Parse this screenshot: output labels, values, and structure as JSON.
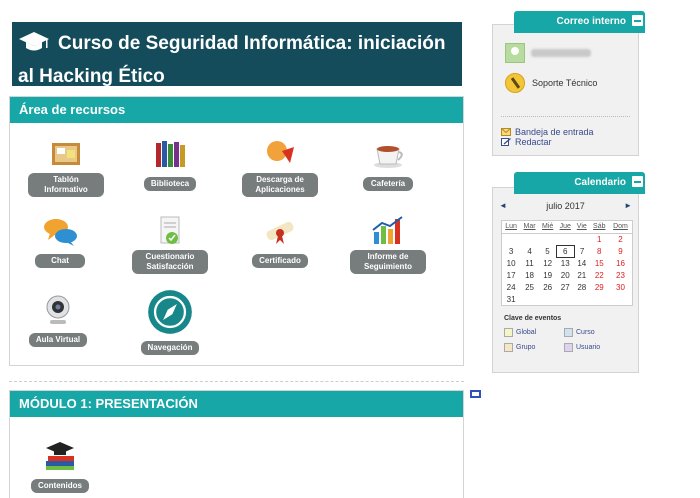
{
  "course": {
    "title": "Curso de Seguridad Informática: iniciación al Hacking Ético",
    "icon": "graduation-cap-icon"
  },
  "resources": {
    "header": "Área de recursos",
    "items": [
      {
        "label": "Tablón Informativo",
        "icon": "bulletin-board-icon"
      },
      {
        "label": "Biblioteca",
        "icon": "books-icon"
      },
      {
        "label": "Descarga de Aplicaciones",
        "icon": "download-apps-icon"
      },
      {
        "label": "Cafetería",
        "icon": "coffee-cup-icon"
      },
      {
        "label": "Chat",
        "icon": "chat-bubbles-icon"
      },
      {
        "label": "Cuestionario Satisfacción",
        "icon": "questionnaire-icon"
      },
      {
        "label": "Certificado",
        "icon": "diploma-icon"
      },
      {
        "label": "Informe de Seguimiento",
        "icon": "report-chart-icon"
      },
      {
        "label": "Aula Virtual",
        "icon": "webcam-icon"
      },
      {
        "label": "Navegación",
        "icon": "compass-icon"
      }
    ]
  },
  "module1": {
    "header": "MÓDULO 1: PRESENTACIÓN",
    "items": [
      {
        "label": "Contenidos",
        "icon": "books-cap-icon"
      }
    ]
  },
  "mail": {
    "title": "Correo interno",
    "support": "Soporte Técnico",
    "inbox": "Bandeja de entrada",
    "compose": "Redactar"
  },
  "calendar": {
    "title": "Calendario",
    "month": "julio 2017",
    "prev": "◄",
    "next": "►",
    "weekdays": [
      "Lun",
      "Mar",
      "Mié",
      "Jue",
      "Vie",
      "Sáb",
      "Dom"
    ],
    "weeks": [
      [
        "",
        "",
        "",
        "",
        "",
        "1",
        "2"
      ],
      [
        "3",
        "4",
        "5",
        "6",
        "7",
        "8",
        "9"
      ],
      [
        "10",
        "11",
        "12",
        "13",
        "14",
        "15",
        "16"
      ],
      [
        "17",
        "18",
        "19",
        "20",
        "21",
        "22",
        "23"
      ],
      [
        "24",
        "25",
        "26",
        "27",
        "28",
        "29",
        "30"
      ],
      [
        "31",
        "",
        "",
        "",
        "",
        "",
        ""
      ]
    ],
    "today": "6",
    "clave_title": "Clave de eventos",
    "clave": [
      {
        "label": "Global",
        "color": "#f4f6c8"
      },
      {
        "label": "Curso",
        "color": "#cfe2f2"
      },
      {
        "label": "Grupo",
        "color": "#f6e6c6"
      },
      {
        "label": "Usuario",
        "color": "#ddd3ef"
      }
    ]
  },
  "colors": {
    "header_bg": "#144c5c",
    "accent": "#17a7a6",
    "label_bg": "#777c7c",
    "weekend": "#dd2222"
  }
}
